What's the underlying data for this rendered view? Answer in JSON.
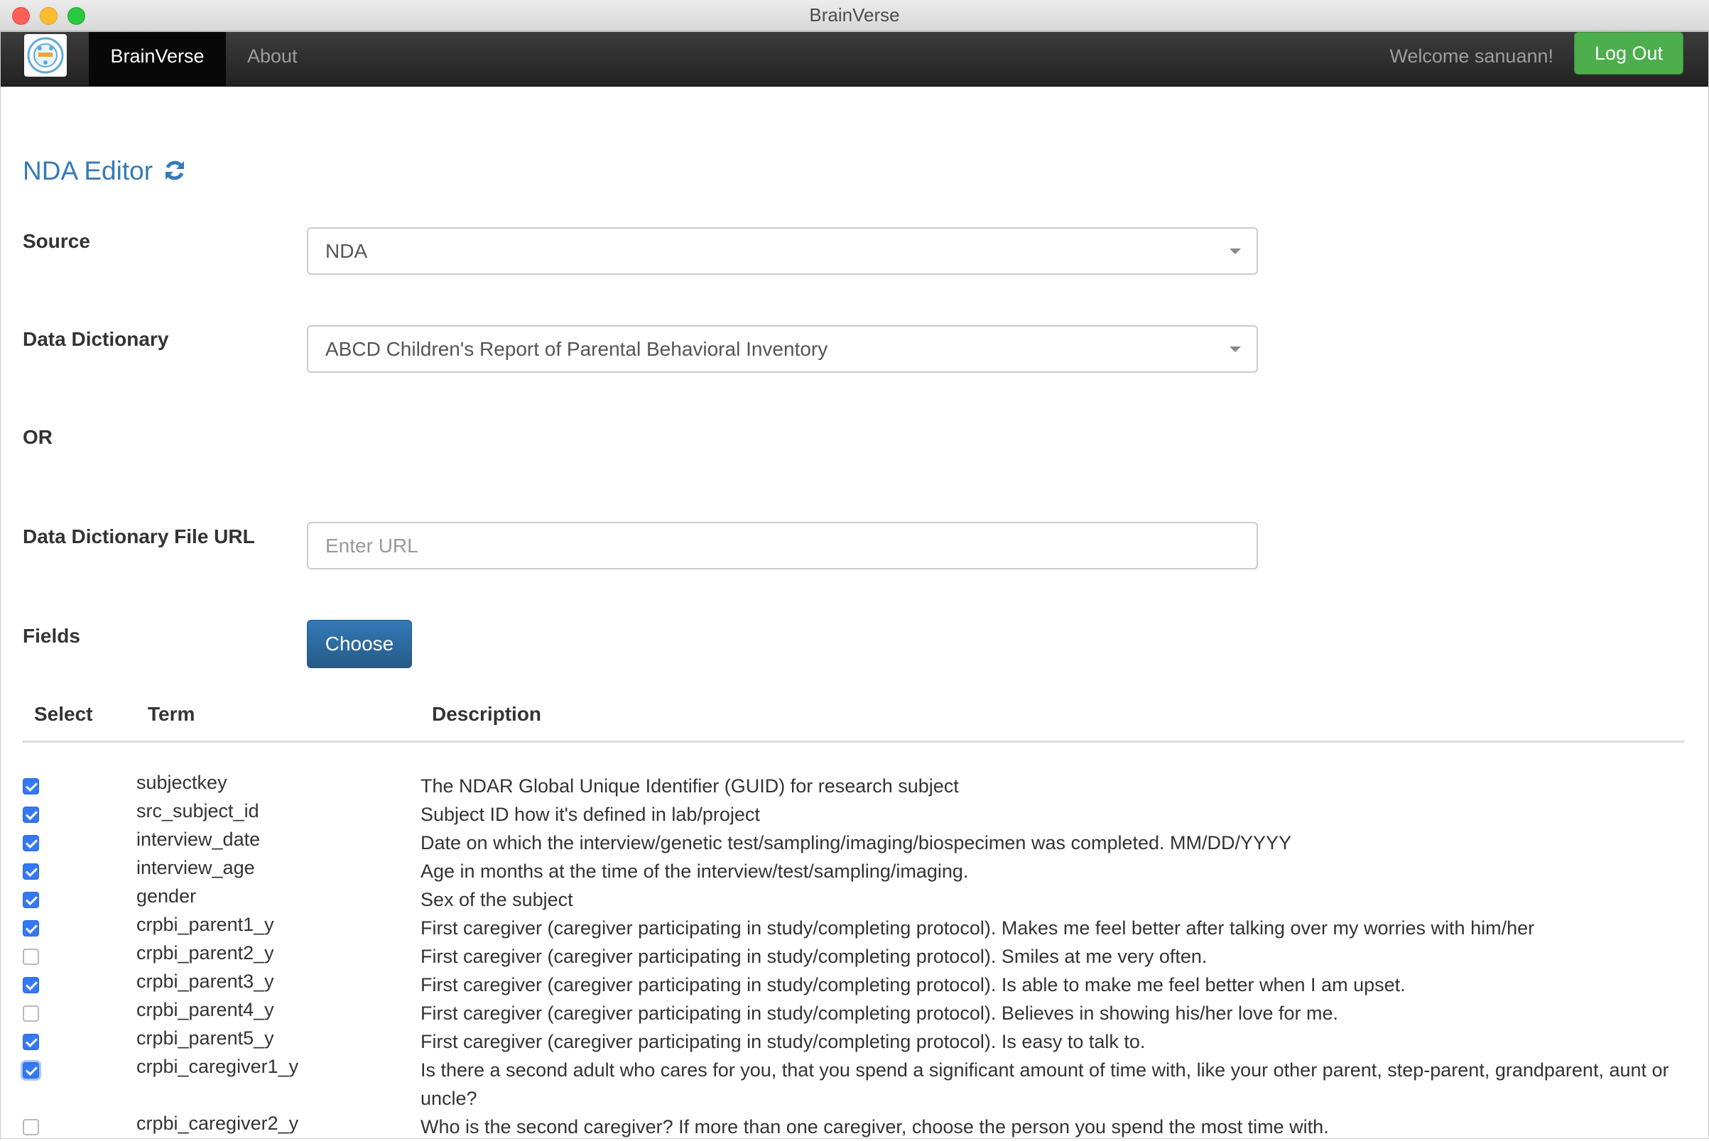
{
  "window": {
    "title": "BrainVerse"
  },
  "navbar": {
    "brand": "BrainVerse",
    "about": "About",
    "welcome": "Welcome sanuann!",
    "logout": "Log Out",
    "logo_icon": "reproin-logo-icon"
  },
  "page": {
    "title": "NDA Editor",
    "refresh_icon": "refresh-icon"
  },
  "form": {
    "source_label": "Source",
    "source_value": "NDA",
    "dictionary_label": "Data Dictionary",
    "dictionary_value": "ABCD Children's Report of Parental Behavioral Inventory",
    "or_label": "OR",
    "url_label": "Data Dictionary File URL",
    "url_placeholder": "Enter URL",
    "url_value": "",
    "fields_label": "Fields",
    "choose_button": "Choose"
  },
  "table": {
    "headers": {
      "select": "Select",
      "term": "Term",
      "description": "Description"
    },
    "rows": [
      {
        "checked": true,
        "term": "subjectkey",
        "description": "The NDAR Global Unique Identifier (GUID) for research subject"
      },
      {
        "checked": true,
        "term": "src_subject_id",
        "description": "Subject ID how it's defined in lab/project"
      },
      {
        "checked": true,
        "term": "interview_date",
        "description": "Date on which the interview/genetic test/sampling/imaging/biospecimen was completed. MM/DD/YYYY"
      },
      {
        "checked": true,
        "term": "interview_age",
        "description": "Age in months at the time of the interview/test/sampling/imaging."
      },
      {
        "checked": true,
        "term": "gender",
        "description": "Sex of the subject"
      },
      {
        "checked": true,
        "term": "crpbi_parent1_y",
        "description": "First caregiver (caregiver participating in study/completing protocol). Makes me feel better after talking over my worries with him/her"
      },
      {
        "checked": false,
        "term": "crpbi_parent2_y",
        "description": "First caregiver (caregiver participating in study/completing protocol). Smiles at me very often."
      },
      {
        "checked": true,
        "term": "crpbi_parent3_y",
        "description": "First caregiver (caregiver participating in study/completing protocol). Is able to make me feel better when I am upset."
      },
      {
        "checked": false,
        "term": "crpbi_parent4_y",
        "description": "First caregiver (caregiver participating in study/completing protocol). Believes in showing his/her love for me."
      },
      {
        "checked": true,
        "term": "crpbi_parent5_y",
        "description": "First caregiver (caregiver participating in study/completing protocol). Is easy to talk to."
      },
      {
        "checked": true,
        "term": "crpbi_caregiver1_y",
        "description": "Is there a second adult who cares for you, that you spend a significant amount of time with, like your other parent, step-parent, grandparent, aunt or uncle?"
      },
      {
        "checked": false,
        "term": "crpbi_caregiver2_y",
        "description": "Who is the second caregiver? If more than one caregiver, choose the person you spend the most time with."
      }
    ]
  },
  "colors": {
    "navbar": "#222222",
    "brand_active": "#080808",
    "logout_green": "#4cae4c",
    "title_blue": "#337ab7",
    "primary_button": "#286090",
    "checkbox_blue": "#3478f6"
  }
}
